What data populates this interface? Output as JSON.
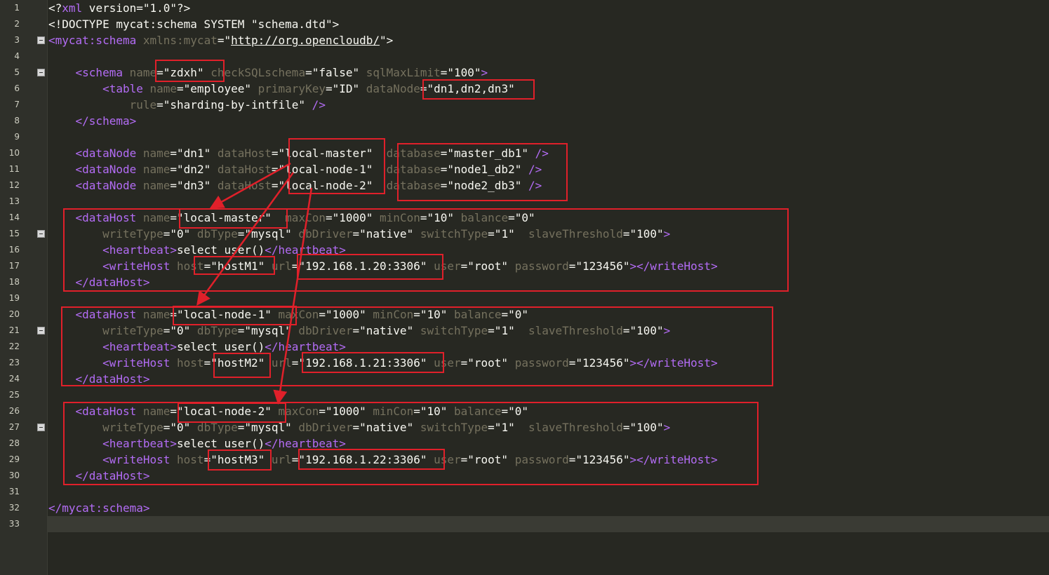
{
  "editor": {
    "current_line": 33,
    "fold_markers": [
      3,
      5,
      15,
      21,
      27
    ],
    "annotation_color": "#e0202a"
  },
  "line_numbers": [
    "1",
    "2",
    "3",
    "4",
    "5",
    "6",
    "7",
    "8",
    "9",
    "10",
    "11",
    "12",
    "13",
    "14",
    "15",
    "16",
    "17",
    "18",
    "19",
    "20",
    "21",
    "22",
    "23",
    "24",
    "25",
    "26",
    "27",
    "28",
    "29",
    "30",
    "31",
    "32",
    "33"
  ],
  "code_lines": [
    [
      {
        "t": "pl",
        "v": "<?"
      },
      {
        "t": "tg",
        "v": "xml"
      },
      {
        "t": "pl",
        "v": " version=\"1.0\"?>"
      }
    ],
    [
      {
        "t": "pl",
        "v": "<!DOCTYPE mycat:schema SYSTEM \"schema.dtd\">"
      }
    ],
    [
      {
        "t": "tg",
        "v": "<mycat:schema"
      },
      {
        "t": "at",
        "v": " xmlns:mycat"
      },
      {
        "t": "eq",
        "v": "=\""
      },
      {
        "t": "ln",
        "v": "http://org.opencloudb/"
      },
      {
        "t": "eq",
        "v": "\">"
      }
    ],
    [],
    [
      {
        "t": "pl",
        "v": "    "
      },
      {
        "t": "tg",
        "v": "<schema"
      },
      {
        "t": "at",
        "v": " name"
      },
      {
        "t": "st",
        "v": "=\"zdxh\""
      },
      {
        "t": "at",
        "v": " checkSQLschema"
      },
      {
        "t": "st",
        "v": "=\"false\""
      },
      {
        "t": "at",
        "v": " sqlMaxLimit"
      },
      {
        "t": "st",
        "v": "=\"100\""
      },
      {
        "t": "tg",
        "v": ">"
      }
    ],
    [
      {
        "t": "pl",
        "v": "        "
      },
      {
        "t": "tg",
        "v": "<table"
      },
      {
        "t": "at",
        "v": " name"
      },
      {
        "t": "st",
        "v": "=\"employee\""
      },
      {
        "t": "at",
        "v": " primaryKey"
      },
      {
        "t": "st",
        "v": "=\"ID\""
      },
      {
        "t": "at",
        "v": " dataNode"
      },
      {
        "t": "st",
        "v": "=\"dn1,dn2,dn3\""
      }
    ],
    [
      {
        "t": "pl",
        "v": "            "
      },
      {
        "t": "at",
        "v": "rule"
      },
      {
        "t": "st",
        "v": "=\"sharding-by-intfile\""
      },
      {
        "t": "tg",
        "v": " />"
      }
    ],
    [
      {
        "t": "pl",
        "v": "    "
      },
      {
        "t": "tg",
        "v": "</schema>"
      }
    ],
    [],
    [
      {
        "t": "pl",
        "v": "    "
      },
      {
        "t": "tg",
        "v": "<dataNode"
      },
      {
        "t": "at",
        "v": " name"
      },
      {
        "t": "st",
        "v": "=\"dn1\""
      },
      {
        "t": "at",
        "v": " dataHost"
      },
      {
        "t": "st",
        "v": "=\"local-master\""
      },
      {
        "t": "at",
        "v": "  database"
      },
      {
        "t": "st",
        "v": "=\"master_db1\""
      },
      {
        "t": "tg",
        "v": " />"
      }
    ],
    [
      {
        "t": "pl",
        "v": "    "
      },
      {
        "t": "tg",
        "v": "<dataNode"
      },
      {
        "t": "at",
        "v": " name"
      },
      {
        "t": "st",
        "v": "=\"dn2\""
      },
      {
        "t": "at",
        "v": " dataHost"
      },
      {
        "t": "st",
        "v": "=\"local-node-1\""
      },
      {
        "t": "at",
        "v": "  database"
      },
      {
        "t": "st",
        "v": "=\"node1_db2\""
      },
      {
        "t": "tg",
        "v": " />"
      }
    ],
    [
      {
        "t": "pl",
        "v": "    "
      },
      {
        "t": "tg",
        "v": "<dataNode"
      },
      {
        "t": "at",
        "v": " name"
      },
      {
        "t": "st",
        "v": "=\"dn3\""
      },
      {
        "t": "at",
        "v": " dataHost"
      },
      {
        "t": "st",
        "v": "=\"local-node-2\""
      },
      {
        "t": "at",
        "v": "  database"
      },
      {
        "t": "st",
        "v": "=\"node2_db3\""
      },
      {
        "t": "tg",
        "v": " />"
      }
    ],
    [],
    [
      {
        "t": "pl",
        "v": "    "
      },
      {
        "t": "tg",
        "v": "<dataHost"
      },
      {
        "t": "at",
        "v": " name"
      },
      {
        "t": "st",
        "v": "=\"local-master\""
      },
      {
        "t": "at",
        "v": "  maxCon"
      },
      {
        "t": "st",
        "v": "=\"1000\""
      },
      {
        "t": "at",
        "v": " minCon"
      },
      {
        "t": "st",
        "v": "=\"10\""
      },
      {
        "t": "at",
        "v": " balance"
      },
      {
        "t": "st",
        "v": "=\"0\""
      }
    ],
    [
      {
        "t": "pl",
        "v": "        "
      },
      {
        "t": "at",
        "v": "writeType"
      },
      {
        "t": "st",
        "v": "=\"0\""
      },
      {
        "t": "at",
        "v": " dbType"
      },
      {
        "t": "st",
        "v": "=\"mysql\""
      },
      {
        "t": "at",
        "v": " dbDriver"
      },
      {
        "t": "st",
        "v": "=\"native\""
      },
      {
        "t": "at",
        "v": " switchType"
      },
      {
        "t": "st",
        "v": "=\"1\""
      },
      {
        "t": "at",
        "v": "  slaveThreshold"
      },
      {
        "t": "st",
        "v": "=\"100\""
      },
      {
        "t": "tg",
        "v": ">"
      }
    ],
    [
      {
        "t": "pl",
        "v": "        "
      },
      {
        "t": "tg",
        "v": "<heartbeat>"
      },
      {
        "t": "pl",
        "v": "select user()"
      },
      {
        "t": "tg",
        "v": "</heartbeat>"
      }
    ],
    [
      {
        "t": "pl",
        "v": "        "
      },
      {
        "t": "tg",
        "v": "<writeHost"
      },
      {
        "t": "at",
        "v": " host"
      },
      {
        "t": "st",
        "v": "=\"hostM1\""
      },
      {
        "t": "at",
        "v": " url"
      },
      {
        "t": "st",
        "v": "=\"192.168.1.20:3306\""
      },
      {
        "t": "at",
        "v": " user"
      },
      {
        "t": "st",
        "v": "=\"root\""
      },
      {
        "t": "at",
        "v": " password"
      },
      {
        "t": "st",
        "v": "=\"123456\""
      },
      {
        "t": "tg",
        "v": "></writeHost>"
      }
    ],
    [
      {
        "t": "pl",
        "v": "    "
      },
      {
        "t": "tg",
        "v": "</dataHost>"
      }
    ],
    [],
    [
      {
        "t": "pl",
        "v": "    "
      },
      {
        "t": "tg",
        "v": "<dataHost"
      },
      {
        "t": "at",
        "v": " name"
      },
      {
        "t": "st",
        "v": "=\"local-node-1\""
      },
      {
        "t": "at",
        "v": " maxCon"
      },
      {
        "t": "st",
        "v": "=\"1000\""
      },
      {
        "t": "at",
        "v": " minCon"
      },
      {
        "t": "st",
        "v": "=\"10\""
      },
      {
        "t": "at",
        "v": " balance"
      },
      {
        "t": "st",
        "v": "=\"0\""
      }
    ],
    [
      {
        "t": "pl",
        "v": "        "
      },
      {
        "t": "at",
        "v": "writeType"
      },
      {
        "t": "st",
        "v": "=\"0\""
      },
      {
        "t": "at",
        "v": " dbType"
      },
      {
        "t": "st",
        "v": "=\"mysql\""
      },
      {
        "t": "at",
        "v": " dbDriver"
      },
      {
        "t": "st",
        "v": "=\"native\""
      },
      {
        "t": "at",
        "v": " switchType"
      },
      {
        "t": "st",
        "v": "=\"1\""
      },
      {
        "t": "at",
        "v": "  slaveThreshold"
      },
      {
        "t": "st",
        "v": "=\"100\""
      },
      {
        "t": "tg",
        "v": ">"
      }
    ],
    [
      {
        "t": "pl",
        "v": "        "
      },
      {
        "t": "tg",
        "v": "<heartbeat>"
      },
      {
        "t": "pl",
        "v": "select user()"
      },
      {
        "t": "tg",
        "v": "</heartbeat>"
      }
    ],
    [
      {
        "t": "pl",
        "v": "        "
      },
      {
        "t": "tg",
        "v": "<writeHost"
      },
      {
        "t": "at",
        "v": " host"
      },
      {
        "t": "st",
        "v": "=\"hostM2\""
      },
      {
        "t": "at",
        "v": " url"
      },
      {
        "t": "st",
        "v": "=\"192.168.1.21:3306\""
      },
      {
        "t": "at",
        "v": " user"
      },
      {
        "t": "st",
        "v": "=\"root\""
      },
      {
        "t": "at",
        "v": " password"
      },
      {
        "t": "st",
        "v": "=\"123456\""
      },
      {
        "t": "tg",
        "v": "></writeHost>"
      }
    ],
    [
      {
        "t": "pl",
        "v": "    "
      },
      {
        "t": "tg",
        "v": "</dataHost>"
      }
    ],
    [],
    [
      {
        "t": "pl",
        "v": "    "
      },
      {
        "t": "tg",
        "v": "<dataHost"
      },
      {
        "t": "at",
        "v": " name"
      },
      {
        "t": "st",
        "v": "=\"local-node-2\""
      },
      {
        "t": "at",
        "v": " maxCon"
      },
      {
        "t": "st",
        "v": "=\"1000\""
      },
      {
        "t": "at",
        "v": " minCon"
      },
      {
        "t": "st",
        "v": "=\"10\""
      },
      {
        "t": "at",
        "v": " balance"
      },
      {
        "t": "st",
        "v": "=\"0\""
      }
    ],
    [
      {
        "t": "pl",
        "v": "        "
      },
      {
        "t": "at",
        "v": "writeType"
      },
      {
        "t": "st",
        "v": "=\"0\""
      },
      {
        "t": "at",
        "v": " dbType"
      },
      {
        "t": "st",
        "v": "=\"mysql\""
      },
      {
        "t": "at",
        "v": " dbDriver"
      },
      {
        "t": "st",
        "v": "=\"native\""
      },
      {
        "t": "at",
        "v": " switchType"
      },
      {
        "t": "st",
        "v": "=\"1\""
      },
      {
        "t": "at",
        "v": "  slaveThreshold"
      },
      {
        "t": "st",
        "v": "=\"100\""
      },
      {
        "t": "tg",
        "v": ">"
      }
    ],
    [
      {
        "t": "pl",
        "v": "        "
      },
      {
        "t": "tg",
        "v": "<heartbeat>"
      },
      {
        "t": "pl",
        "v": "select user()"
      },
      {
        "t": "tg",
        "v": "</heartbeat>"
      }
    ],
    [
      {
        "t": "pl",
        "v": "        "
      },
      {
        "t": "tg",
        "v": "<writeHost"
      },
      {
        "t": "at",
        "v": " host"
      },
      {
        "t": "st",
        "v": "=\"hostM3\""
      },
      {
        "t": "at",
        "v": " url"
      },
      {
        "t": "st",
        "v": "=\"192.168.1.22:3306\""
      },
      {
        "t": "at",
        "v": " user"
      },
      {
        "t": "st",
        "v": "=\"root\""
      },
      {
        "t": "at",
        "v": " password"
      },
      {
        "t": "st",
        "v": "=\"123456\""
      },
      {
        "t": "tg",
        "v": "></writeHost>"
      }
    ],
    [
      {
        "t": "pl",
        "v": "    "
      },
      {
        "t": "tg",
        "v": "</dataHost>"
      }
    ],
    [],
    [
      {
        "t": "tg",
        "v": "</mycat:schema>"
      }
    ],
    []
  ]
}
